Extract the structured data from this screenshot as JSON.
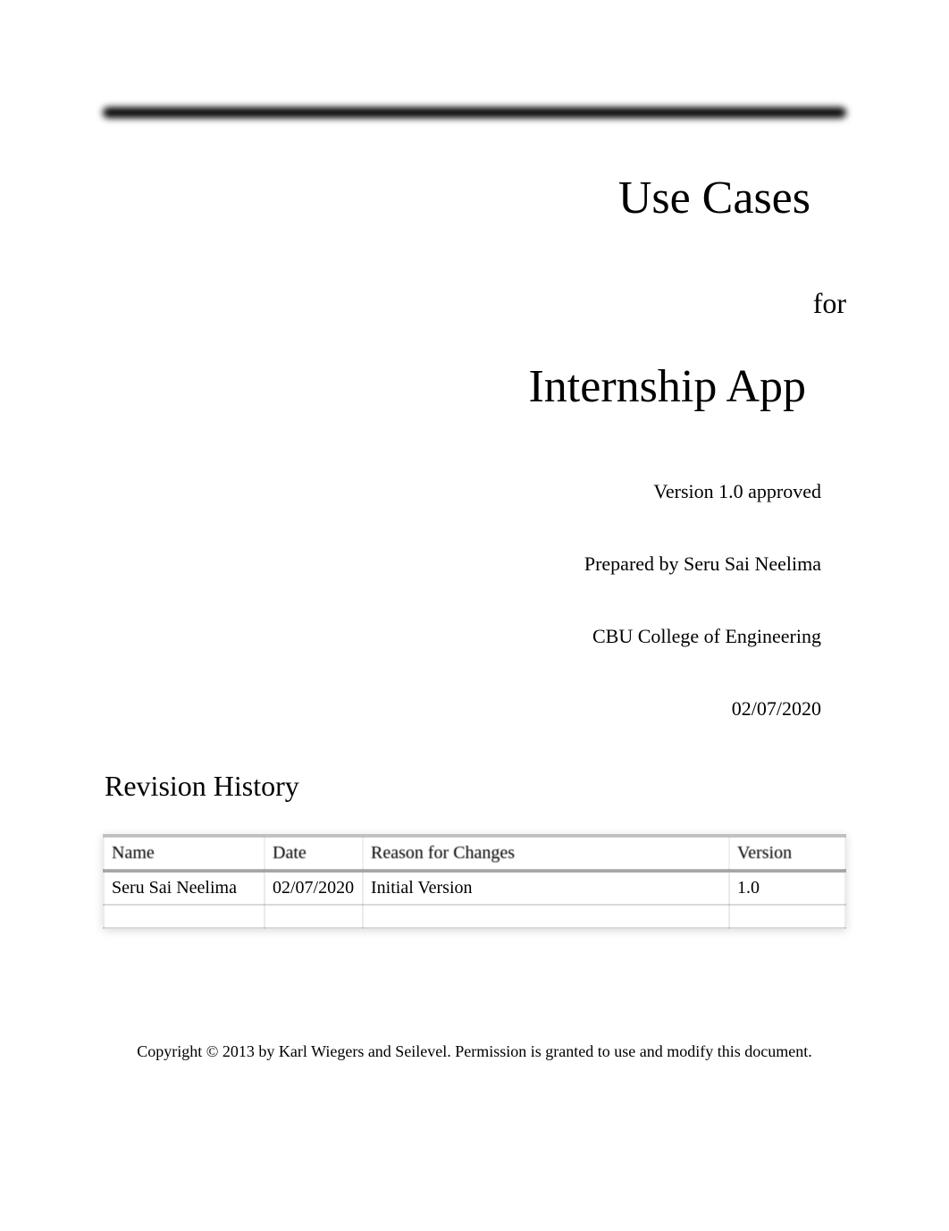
{
  "title": {
    "line1": "Use Cases",
    "for": "for",
    "line2": "Internship App"
  },
  "meta": {
    "version_status": "Version 1.0 approved",
    "prepared_by": "Prepared by Seru Sai Neelima",
    "organization": "CBU College of Engineering",
    "date": "02/07/2020"
  },
  "revision": {
    "heading": "Revision History",
    "headers": {
      "name": "Name",
      "date": "Date",
      "reason": "Reason for Changes",
      "version": "Version"
    },
    "rows": [
      {
        "name": "Seru Sai Neelima",
        "date": "02/07/2020",
        "reason": "Initial Version",
        "version": "1.0"
      },
      {
        "name": "",
        "date": "",
        "reason": "",
        "version": ""
      }
    ]
  },
  "footer": "Copyright © 2013 by Karl Wiegers and Seilevel. Permission is granted to use and modify this document."
}
